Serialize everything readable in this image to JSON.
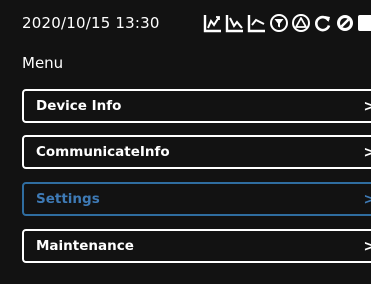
{
  "status": {
    "datetime": "2020/10/15 13:30",
    "icons": [
      "chart-up-icon",
      "chart-down-icon",
      "chart-flat-icon",
      "filter-icon",
      "warning-icon",
      "refresh-icon",
      "no-entry-icon",
      "square-icon"
    ]
  },
  "menu": {
    "title": "Menu",
    "items": [
      {
        "label": "Device Info",
        "selected": false
      },
      {
        "label": "CommunicateInfo",
        "selected": false
      },
      {
        "label": "Settings",
        "selected": true
      },
      {
        "label": "Maintenance",
        "selected": false
      }
    ]
  },
  "colors": {
    "background": "#121212",
    "border": "#ffffff",
    "selected_border": "#2f6da0",
    "selected_text": "#3e7ab5"
  }
}
